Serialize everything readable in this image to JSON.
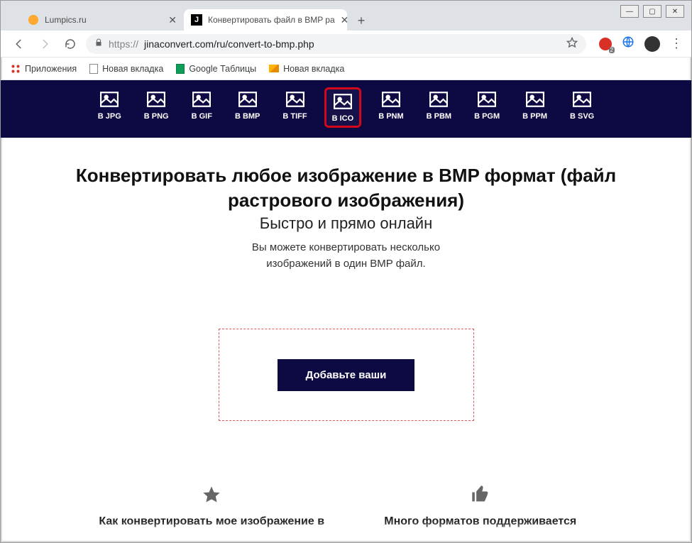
{
  "window": {
    "minimize": "—",
    "maximize": "▢",
    "close": "✕"
  },
  "tabs": [
    {
      "title": "Lumpics.ru",
      "close": "✕"
    },
    {
      "title": "Конвертировать файл в BMP ра",
      "close": "✕"
    }
  ],
  "new_tab": "+",
  "address": {
    "scheme": "https://",
    "host_path": "jinaconvert.com/ru/convert-to-bmp.php"
  },
  "ext_badge": "2",
  "bookmarks": {
    "apps": "Приложения",
    "new_tab1": "Новая вкладка",
    "sheets": "Google Таблицы",
    "new_tab2": "Новая вкладка"
  },
  "formats": [
    "В JPG",
    "В PNG",
    "В GIF",
    "В BMP",
    "В TIFF",
    "В ICO",
    "В PNM",
    "В PBM",
    "В PGM",
    "В PPM",
    "В SVG"
  ],
  "highlight_index": 5,
  "main": {
    "heading": "Конвертировать любое изображение в BMP формат (файл растрового изображения)",
    "subheading": "Быстро и прямо онлайн",
    "desc1": "Вы можете конвертировать несколько",
    "desc2": "изображений в один BMP файл.",
    "add_button": "Добавьте ваши"
  },
  "features": {
    "left_title": "Как конвертировать мое изображение в",
    "right_title": "Много форматов поддерживается"
  }
}
